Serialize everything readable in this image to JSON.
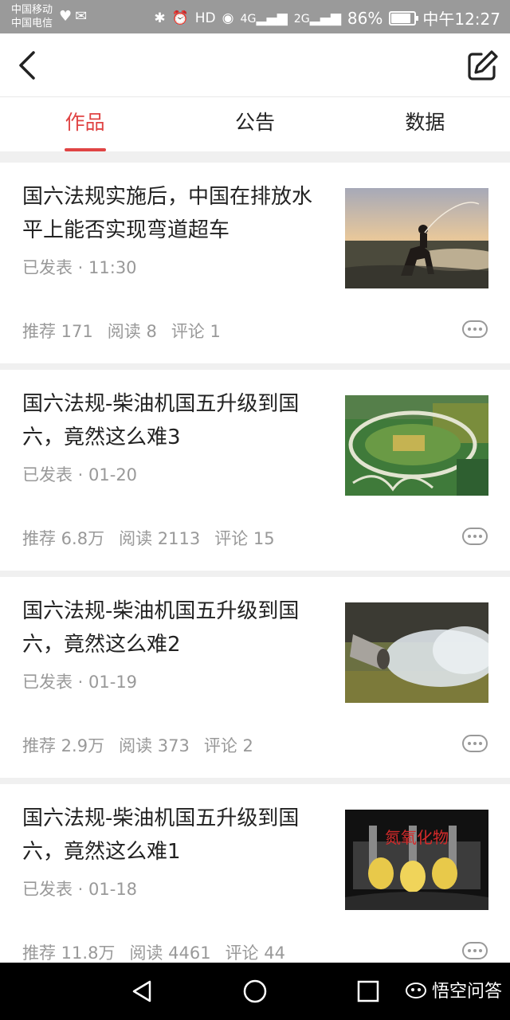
{
  "status_bar": {
    "carrier_1": "中国移动",
    "carrier_2": "中国电信",
    "network_4g": "4G",
    "network_2g": "2G",
    "battery": "86%",
    "battery_level": 0.86,
    "time": "中午12:27"
  },
  "tabs": [
    {
      "label": "作品",
      "active": true
    },
    {
      "label": "公告",
      "active": false
    },
    {
      "label": "数据",
      "active": false
    }
  ],
  "articles": [
    {
      "title": "国六法规实施后，中国在排放水平上能否实现弯道超车",
      "meta": "已发表 · 11:30",
      "recommend": "推荐 171",
      "reads": "阅读 8",
      "comments": "评论 1",
      "thumb": "cowboy-on-horse"
    },
    {
      "title": "国六法规-柴油机国五升级到国六，竟然这么难3",
      "meta": "已发表 · 01-20",
      "recommend": "推荐 6.8万",
      "reads": "阅读 2113",
      "comments": "评论 15",
      "thumb": "test-track-aerial"
    },
    {
      "title": "国六法规-柴油机国五升级到国六，竟然这么难2",
      "meta": "已发表 · 01-19",
      "recommend": "推荐 2.9万",
      "reads": "阅读 373",
      "comments": "评论 2",
      "thumb": "exhaust-pipe-smoke"
    },
    {
      "title": "国六法规-柴油机国五升级到国六，竟然这么难1",
      "meta": "已发表 · 01-18",
      "recommend": "推荐 11.8万",
      "reads": "阅读 4461",
      "comments": "评论 44",
      "thumb": "engine-pistons",
      "thumb_caption": "氮氧化物"
    }
  ],
  "watermark": "悟空问答",
  "colors": {
    "accent": "#e04444",
    "muted_text": "#999999",
    "status_bar": "#9a9a9a"
  }
}
